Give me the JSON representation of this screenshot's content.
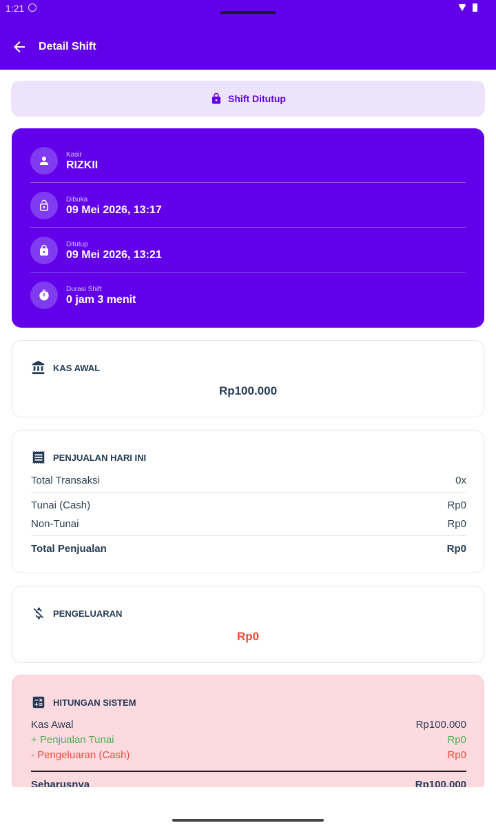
{
  "status_bar": {
    "time": "1:21"
  },
  "app_bar": {
    "title": "Detail Shift"
  },
  "shift_status": {
    "label": "Shift Ditutup"
  },
  "info": [
    {
      "label": "Kasir",
      "value": "RIZKII",
      "icon": "person-icon"
    },
    {
      "label": "Dibuka",
      "value": "09 Mei 2026, 13:17",
      "icon": "lock-open-icon"
    },
    {
      "label": "Ditutup",
      "value": "09 Mei 2026, 13:21",
      "icon": "lock-icon"
    },
    {
      "label": "Durasi Shift",
      "value": "0 jam 3 menit",
      "icon": "timer-icon"
    }
  ],
  "kas_awal": {
    "title": "KAS AWAL",
    "amount": "Rp100.000"
  },
  "penjualan": {
    "title": "PENJUALAN HARI INI",
    "rows": [
      {
        "label": "Total Transaksi",
        "value": "0x"
      },
      {
        "label": "Tunai (Cash)",
        "value": "Rp0"
      },
      {
        "label": "Non-Tunai",
        "value": "Rp0"
      },
      {
        "label": "Total Penjualan",
        "value": "Rp0"
      }
    ]
  },
  "pengeluaran": {
    "title": "PENGELUARAN",
    "amount": "Rp0"
  },
  "hitungan": {
    "title": "HITUNGAN SISTEM",
    "rows": [
      {
        "label": "Kas Awal",
        "value": "Rp100.000"
      },
      {
        "label": "+ Penjualan Tunai",
        "value": "Rp0"
      },
      {
        "label": "- Pengeluaran (Cash)",
        "value": "Rp0"
      },
      {
        "label": "Seharusnya",
        "value": "Rp100.000"
      }
    ]
  },
  "colors": {
    "primary": "#6200ea",
    "danger": "#e74c3c",
    "success": "#4caf50",
    "heading": "#243b55"
  }
}
